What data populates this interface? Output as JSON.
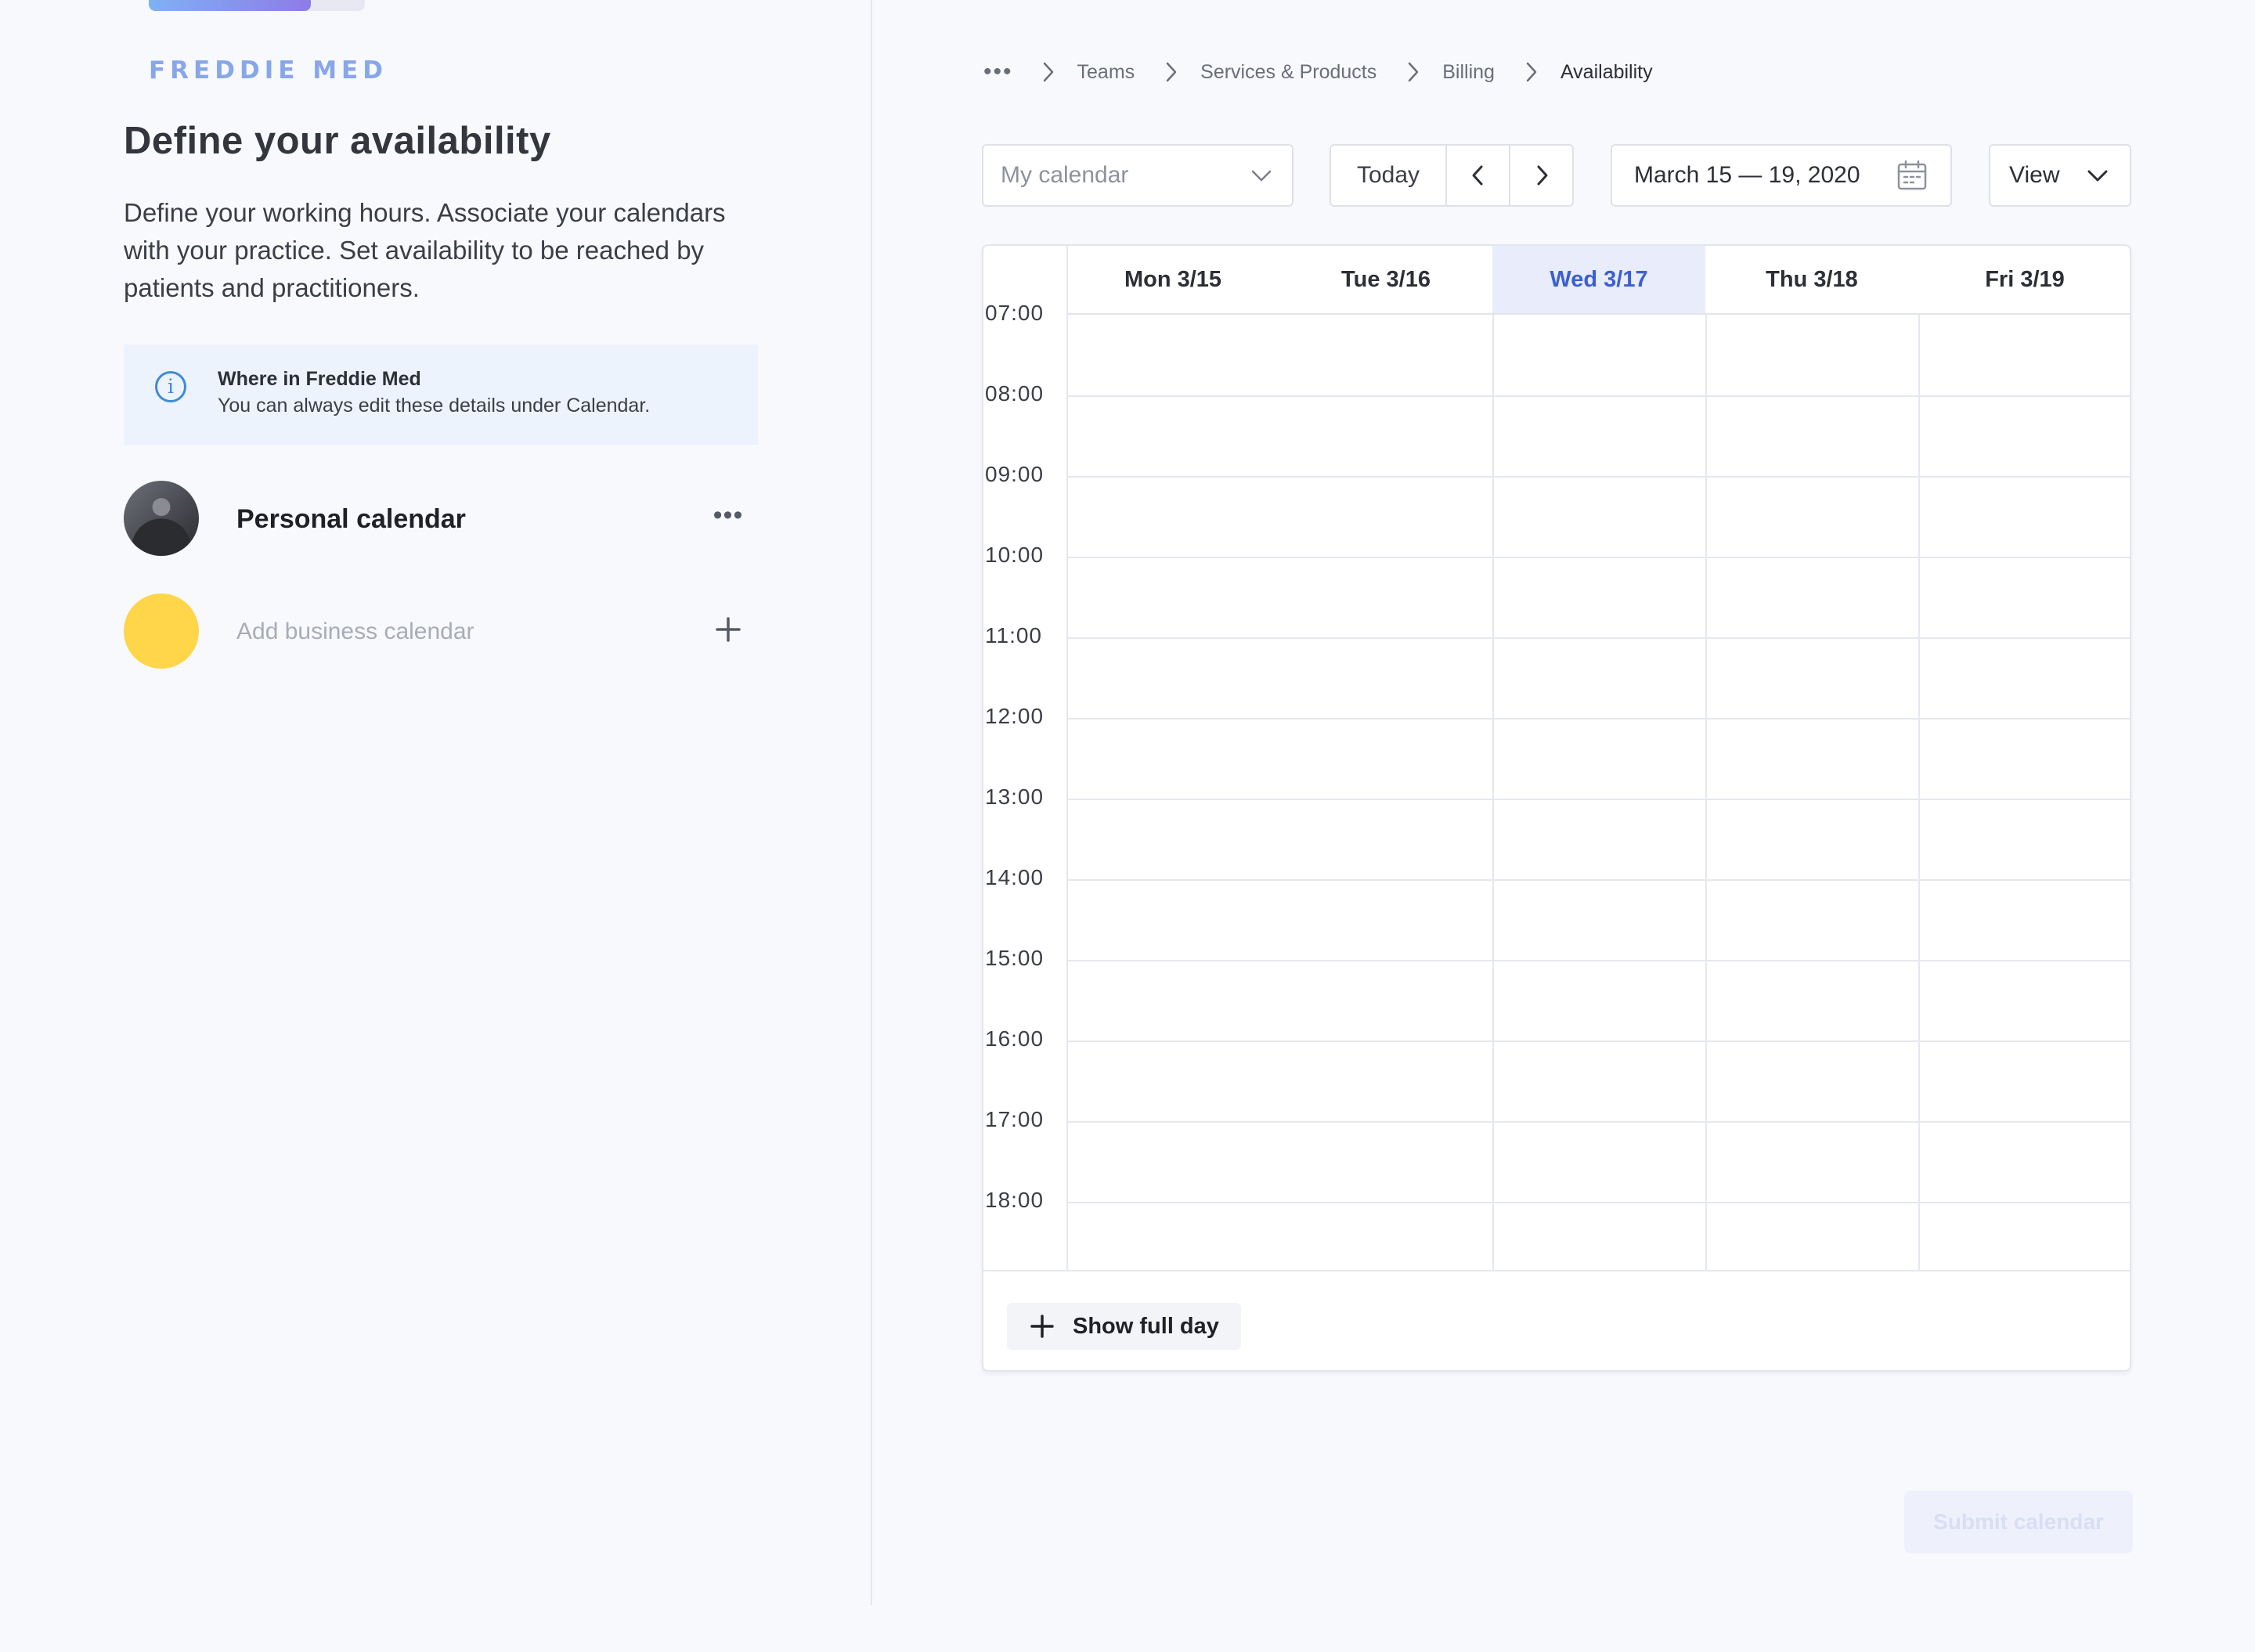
{
  "progress": {
    "fraction": 0.75
  },
  "brand": {
    "logo_text": "FREDDIE MED"
  },
  "intro": {
    "title": "Define your availability",
    "description": "Define your working hours. Associate your calendars with your practice. Set availability to be reached by patients and practitioners."
  },
  "info": {
    "title": "Where in Freddie Med",
    "text": "You can always edit these details under Calendar."
  },
  "calendars": {
    "personal_label": "Personal calendar",
    "add_label": "Add business calendar"
  },
  "breadcrumb": {
    "items": [
      "Teams",
      "Services & Products",
      "Billing",
      "Availability"
    ]
  },
  "toolbar": {
    "calendar_placeholder": "My calendar",
    "today_label": "Today",
    "date_range": "March 15 — 19, 2020",
    "view_label": "View"
  },
  "grid": {
    "days": [
      "Mon 3/15",
      "Tue 3/16",
      "Wed 3/17",
      "Thu 3/18",
      "Fri 3/19"
    ],
    "active_day": "Wed 3/17",
    "hours": [
      "07:00",
      "08:00",
      "09:00",
      "10:00",
      "11:00",
      "12:00",
      "13:00",
      "14:00",
      "15:00",
      "16:00",
      "17:00",
      "18:00"
    ],
    "show_full_day_label": "Show full day"
  },
  "footer": {
    "submit_label": "Submit calendar"
  },
  "colors": {
    "accent": "#3c5fd0",
    "active_day_bg": "#e8ecfb",
    "business_calendar_dot": "#ffd64a",
    "info_icon": "#3d8bd8"
  }
}
